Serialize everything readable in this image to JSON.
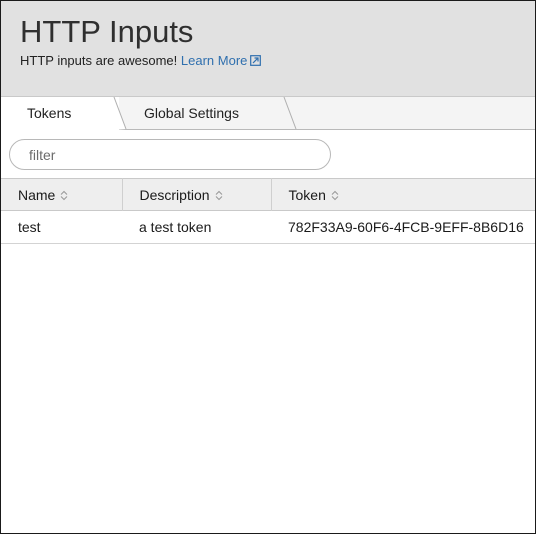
{
  "header": {
    "title": "HTTP Inputs",
    "subtitle": "HTTP inputs are awesome!",
    "learn_more": "Learn More"
  },
  "tabs": [
    {
      "label": "Tokens",
      "active": true
    },
    {
      "label": "Global Settings",
      "active": false
    }
  ],
  "filter": {
    "placeholder": "filter",
    "value": ""
  },
  "table": {
    "columns": [
      {
        "label": "Name",
        "sort_icon": "sort-icon"
      },
      {
        "label": "Description",
        "sort_icon": "sort-icon"
      },
      {
        "label": "Token",
        "sort_icon": "sort-icon"
      }
    ],
    "rows": [
      {
        "name": "test",
        "description": "a test token",
        "token": "782F33A9-60F6-4FCB-9EFF-8B6D16"
      }
    ]
  },
  "colors": {
    "header_bg": "#e1e1e1",
    "link": "#2f6fae",
    "table_header_bg": "#eeeeee"
  }
}
